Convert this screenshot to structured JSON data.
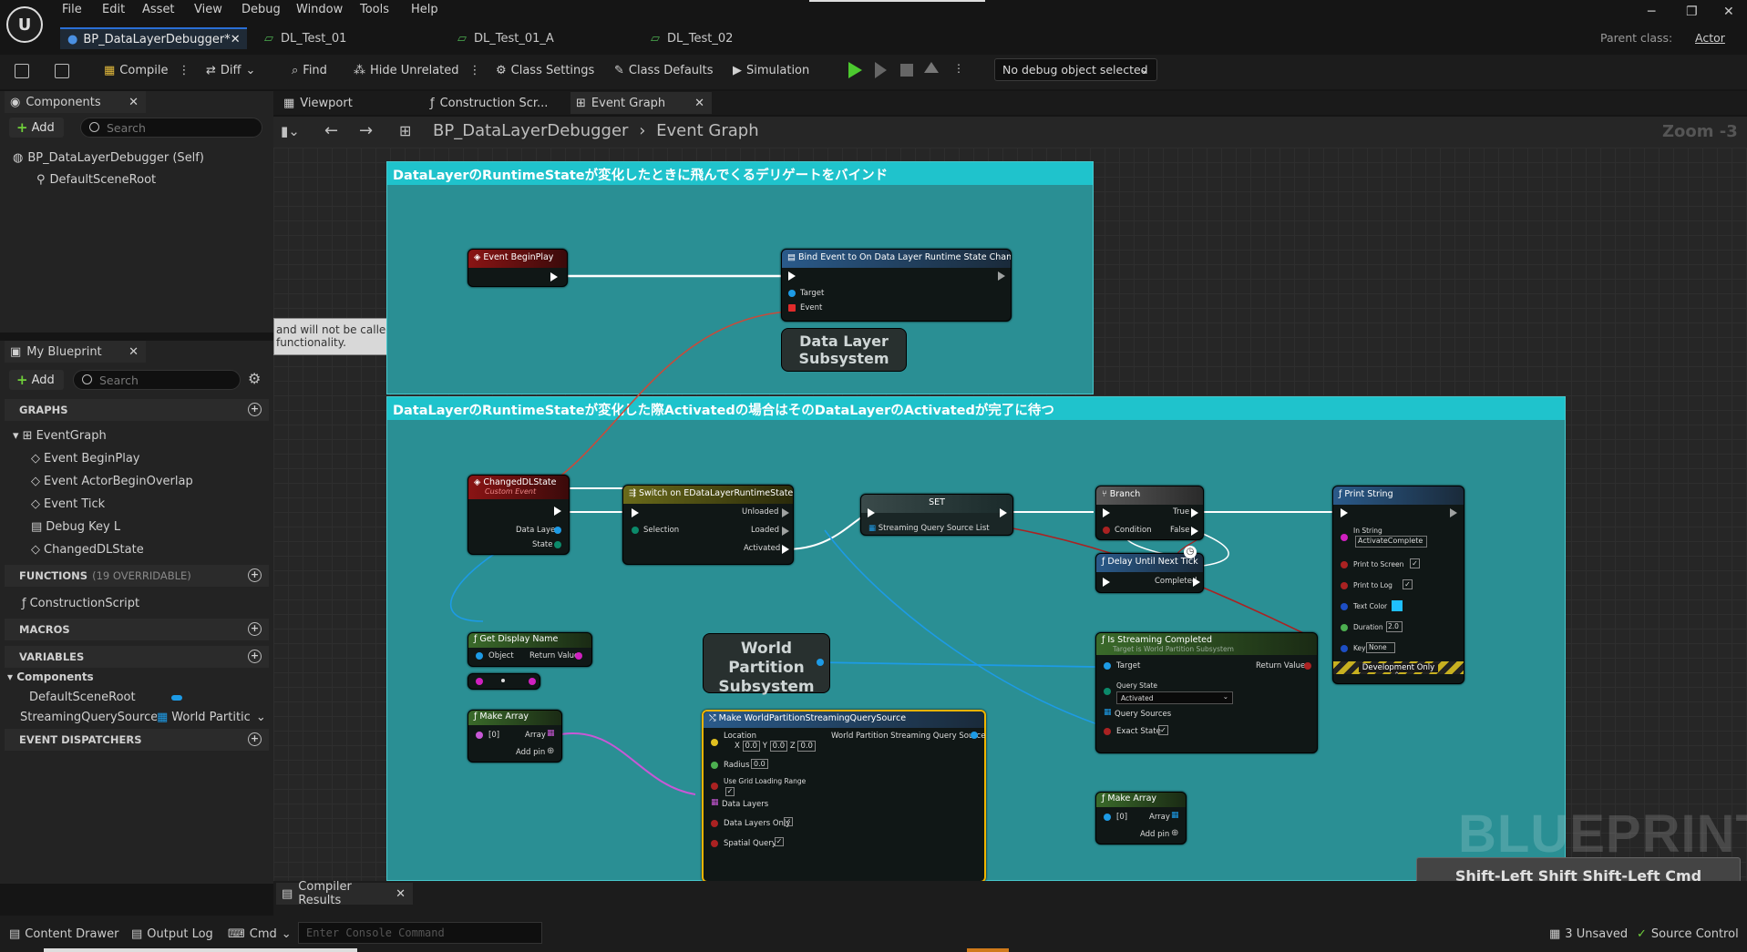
{
  "menu": [
    "File",
    "Edit",
    "Asset",
    "View",
    "Debug",
    "Window",
    "Tools",
    "Help"
  ],
  "tabs": [
    {
      "label": "BP_DataLayerDebugger*"
    },
    {
      "label": "DL_Test_01"
    },
    {
      "label": "DL_Test_01_A"
    },
    {
      "label": "DL_Test_02"
    }
  ],
  "parent_class": {
    "label": "Parent class:",
    "value": "Actor"
  },
  "toolbar": {
    "compile": "Compile",
    "diff": "Diff",
    "find": "Find",
    "hide_unrelated": "Hide Unrelated",
    "class_settings": "Class Settings",
    "class_defaults": "Class Defaults",
    "simulation": "Simulation",
    "debug_object": "No debug object selected"
  },
  "components_panel": {
    "title": "Components",
    "add": "Add",
    "search_placeholder": "Search",
    "items": [
      "BP_DataLayerDebugger (Self)",
      "DefaultSceneRoot"
    ]
  },
  "my_blueprint": {
    "title": "My Blueprint",
    "add": "Add",
    "search_placeholder": "Search",
    "graphs_header": "GRAPHS",
    "event_graph": "EventGraph",
    "events": [
      "Event BeginPlay",
      "Event ActorBeginOverlap",
      "Event Tick",
      "Debug Key L",
      "ChangedDLState"
    ],
    "functions_header": "FUNCTIONS",
    "functions_count": "(19 OVERRIDABLE)",
    "functions": [
      "ConstructionScript"
    ],
    "macros_header": "MACROS",
    "variables_header": "VARIABLES",
    "var_category": "Components",
    "variables": [
      {
        "name": "DefaultSceneRoot",
        "type": ""
      },
      {
        "name": "StreamingQuerySourceLi",
        "type": "World Partitic"
      }
    ],
    "dispatchers_header": "EVENT DISPATCHERS"
  },
  "graph_tabs": [
    {
      "label": "Viewport"
    },
    {
      "label": "Construction Scr..."
    },
    {
      "label": "Event Graph"
    }
  ],
  "breadcrumb": {
    "blueprint": "BP_DataLayerDebugger",
    "graph": "Event Graph"
  },
  "zoom": "Zoom -3",
  "comments": [
    "DataLayerのRuntimeStateが変化したときに飛んでくるデリゲートをバインド",
    "DataLayerのRuntimeStateが変化した際Activatedの場合はそのDataLayerのActivatedが完了に待つ"
  ],
  "tooltip_fragment": [
    "and will not be called.",
    "functionality."
  ],
  "nodes": {
    "begin_play": "Event BeginPlay",
    "bind_event": "Bind Event to On Data Layer Runtime State Changed",
    "bind_target": "Target",
    "bind_event_pin": "Event",
    "data_layer_subsystem": "Data Layer Subsystem",
    "changed_dl_state": "ChangedDLState",
    "custom_event": "Custom Event",
    "data_layer": "Data Layer",
    "state": "State",
    "switch": "Switch on EDataLayerRuntimeState",
    "selection": "Selection",
    "unloaded": "Unloaded",
    "loaded": "Loaded",
    "activated": "Activated",
    "set": "SET",
    "streaming_query_source_list": "Streaming Query Source List",
    "branch": "Branch",
    "condition": "Condition",
    "true": "True",
    "false": "False",
    "delay": "Delay Until Next Tick",
    "completed": "Completed",
    "print_string": "Print String",
    "in_string": "In String",
    "in_string_value": "ActivateComplete",
    "print_to_screen": "Print to Screen",
    "print_to_log": "Print to Log",
    "text_color": "Text Color",
    "duration": "Duration",
    "duration_value": "2.0",
    "key": "Key",
    "key_value": "None",
    "development_only": "Development Only",
    "get_display_name": "Get Display Name",
    "object": "Object",
    "return_value": "Return Value",
    "world_partition_subsystem": "World Partition Subsystem",
    "is_streaming_completed": "Is Streaming Completed",
    "target_is": "Target is World Partition Subsystem",
    "target": "Target",
    "query_state": "Query State",
    "query_state_value": "Activated",
    "query_sources": "Query Sources",
    "exact_state": "Exact State",
    "make_array": "Make Array",
    "idx0": "[0]",
    "array": "Array",
    "add_pin": "Add pin",
    "make_wp": "Make WorldPartitionStreamingQuerySource",
    "location": "Location",
    "x": "0.0",
    "y": "0.0",
    "z": "0.0",
    "wp_sqs": "World Partition Streaming Query Source",
    "radius": "Radius",
    "radius_value": "0.0",
    "use_grid": "Use Grid Loading Range",
    "data_layers": "Data Layers",
    "data_layers_only": "Data Layers Only",
    "spatial_query": "Spatial Query"
  },
  "watermark": "BLUEPRINT",
  "shortcut_hint": "Shift-Left Shift  Shift-Left Cmd",
  "compiler_results": "Compiler Results",
  "bottom": {
    "content_drawer": "Content Drawer",
    "output_log": "Output Log",
    "cmd": "Cmd",
    "console_placeholder": "Enter Console Command",
    "unsaved": "3 Unsaved",
    "source_control": "Source Control"
  },
  "colors": {
    "accent": "#1fc3cc",
    "exec": "#ffffff",
    "object_pin": "#1d9be6",
    "array_pin": "#c858d6"
  }
}
